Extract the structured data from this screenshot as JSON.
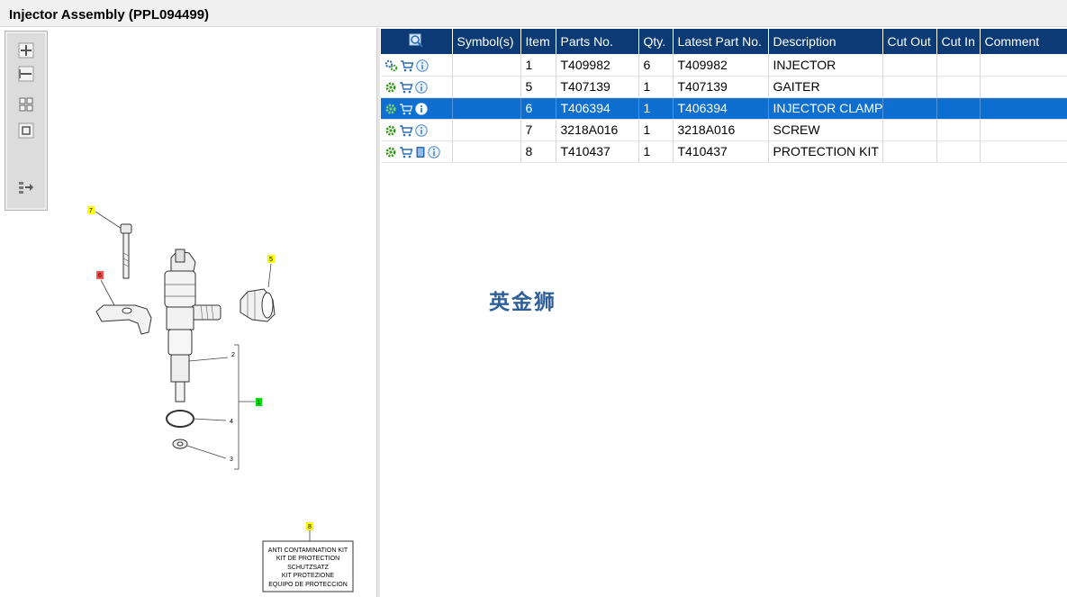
{
  "window": {
    "title": "Injector Assembly (PPL094499)"
  },
  "toolbar": {
    "tools": [
      "zoom-in-icon",
      "zoom-out-icon",
      "fit-all-icon",
      "actual-size-icon",
      "export-icon"
    ]
  },
  "drawing": {
    "callouts": {
      "c7": "7",
      "c6": "6",
      "c5": "5",
      "c1": "1",
      "c2": "2",
      "c4": "4",
      "c3": "3",
      "c8": "8"
    },
    "callout_colors": {
      "yellow": "#ffff00",
      "red": "#ff5050",
      "green": "#00e000"
    },
    "kit_label": {
      "line1": "ANTI CONTAMINATION KIT",
      "line2": "KIT DE PROTECTION",
      "line3": "SCHUTZSATZ",
      "line4": "KIT PROTEZIONE",
      "line5": "EQUIPO DE PROTECCION"
    }
  },
  "table": {
    "header_icon": "search-icon",
    "columns": {
      "symbols": "Symbol(s)",
      "item": "Item",
      "parts_no": "Parts No.",
      "qty": "Qty.",
      "latest_part_no": "Latest Part No.",
      "description": "Description",
      "cut_out": "Cut Out",
      "cut_in": "Cut In",
      "comment": "Comment"
    },
    "rows": [
      {
        "icons": [
          "gears-icon",
          "cart-icon",
          "info-icon"
        ],
        "symbols": "",
        "item": "1",
        "parts_no": "T409982",
        "qty": "6",
        "latest_part_no": "T409982",
        "description": "INJECTOR",
        "cut_out": "",
        "cut_in": "",
        "comment": ""
      },
      {
        "icons": [
          "gear-icon",
          "cart-icon",
          "info-icon"
        ],
        "symbols": "",
        "item": "5",
        "parts_no": "T407139",
        "qty": "1",
        "latest_part_no": "T407139",
        "description": "GAITER",
        "cut_out": "",
        "cut_in": "",
        "comment": ""
      },
      {
        "icons": [
          "gear-icon",
          "cart-icon",
          "info-icon"
        ],
        "symbols": "",
        "item": "6",
        "parts_no": "T406394",
        "qty": "1",
        "latest_part_no": "T406394",
        "description": "INJECTOR CLAMP",
        "cut_out": "",
        "cut_in": "",
        "comment": ""
      },
      {
        "icons": [
          "gear-icon",
          "cart-icon",
          "info-icon"
        ],
        "symbols": "",
        "item": "7",
        "parts_no": "3218A016",
        "qty": "1",
        "latest_part_no": "3218A016",
        "description": "SCREW",
        "cut_out": "",
        "cut_in": "",
        "comment": ""
      },
      {
        "icons": [
          "gear-icon",
          "cart-icon",
          "book-icon",
          "info-icon"
        ],
        "symbols": "",
        "item": "8",
        "parts_no": "T410437",
        "qty": "1",
        "latest_part_no": "T410437",
        "description": "PROTECTION KIT",
        "cut_out": "",
        "cut_in": "",
        "comment": ""
      }
    ],
    "selected_row_index": 2
  },
  "watermark": {
    "text": "英金狮"
  },
  "colors": {
    "header_bg": "#0b3a75",
    "selected_row_bg": "#0f6fd0",
    "gear_green": "#3a9a1e",
    "cart_blue": "#2a6db5",
    "info_blue": "#4a86c8",
    "watermark": "#2f5f9a"
  }
}
